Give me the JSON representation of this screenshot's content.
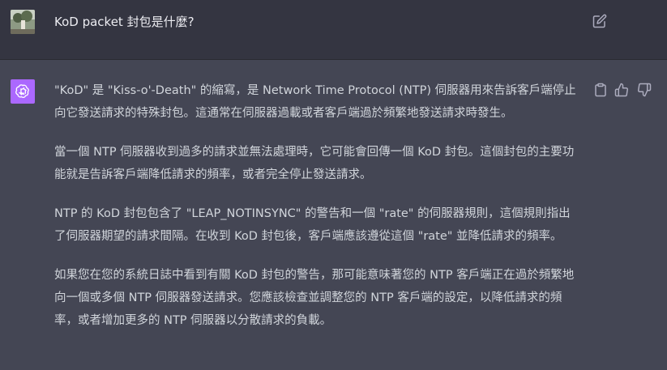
{
  "user_message": {
    "text": "KoD packet 封包是什麼?",
    "avatar_icon": "user-photo-icon",
    "edit_icon": "edit-icon"
  },
  "assistant_message": {
    "avatar_icon": "openai-logo-icon",
    "avatar_color": "#ab68ff",
    "paragraphs": [
      "\"KoD\" 是 \"Kiss-o'-Death\" 的縮寫，是 Network Time Protocol (NTP) 伺服器用來告訴客戶端停止向它發送請求的特殊封包。這通常在伺服器過載或者客戶端過於頻繁地發送請求時發生。",
      "當一個 NTP 伺服器收到過多的請求並無法處理時，它可能會回傳一個 KoD 封包。這個封包的主要功能就是告訴客戶端降低請求的頻率，或者完全停止發送請求。",
      "NTP 的 KoD 封包包含了 \"LEAP_NOTINSYNC\" 的警告和一個 \"rate\" 的伺服器規則，這個規則指出了伺服器期望的請求間隔。在收到 KoD 封包後，客戶端應該遵從這個 \"rate\" 並降低請求的頻率。",
      "如果您在您的系統日誌中看到有關 KoD 封包的警告，那可能意味著您的 NTP 客戶端正在過於頻繁地向一個或多個 NTP 伺服器發送請求。您應該檢查並調整您的 NTP 客戶端的設定，以降低請求的頻率，或者增加更多的 NTP 伺服器以分散請求的負載。"
    ],
    "actions": [
      "copy-icon",
      "thumbs-up-icon",
      "thumbs-down-icon"
    ]
  },
  "colors": {
    "user_bg": "#343541",
    "assistant_bg": "#444654",
    "text": "#d1d5db"
  }
}
